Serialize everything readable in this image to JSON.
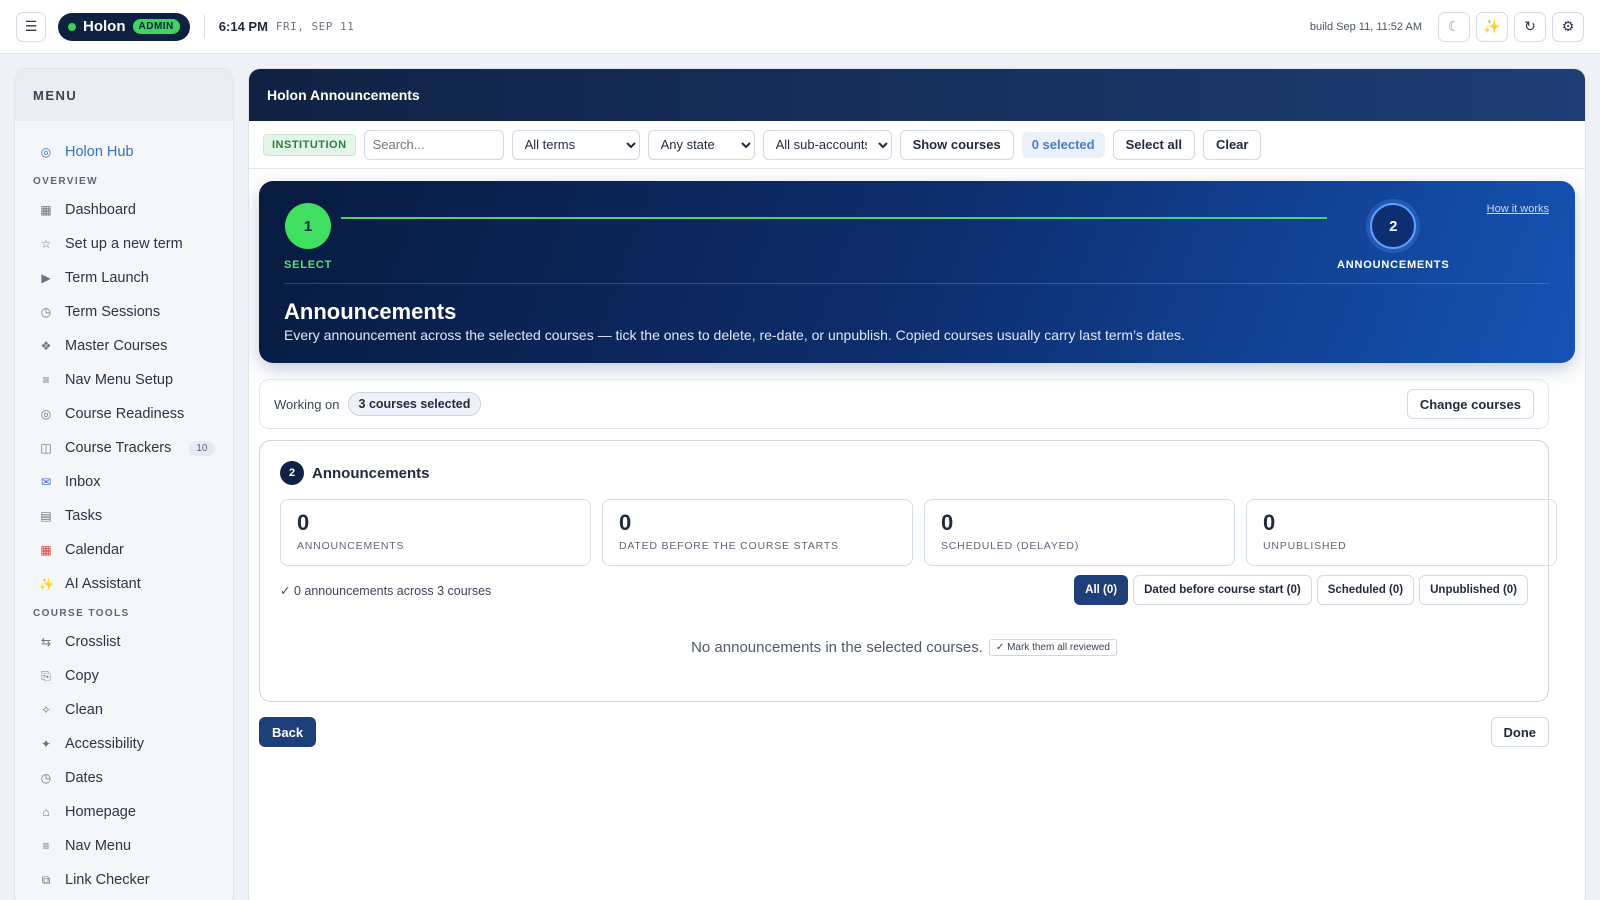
{
  "topbar": {
    "menu_icon": "hamburger-icon",
    "brand_name": "Holon",
    "brand_badge": "ADMIN",
    "time": "6:14 PM",
    "date": "FRI, SEP 11",
    "build": "build Sep 11, 11:52 AM",
    "actions": [
      "moon-icon",
      "sparkles-icon",
      "refresh-icon",
      "gear-icon"
    ]
  },
  "sidebar": {
    "menu_title": "MENU",
    "hub": "Holon Hub",
    "overview_label": "OVERVIEW",
    "overview_items": [
      {
        "label": "Dashboard",
        "icon": "grid-icon"
      },
      {
        "label": "Set up a new term",
        "icon": "star-icon"
      },
      {
        "label": "Term Launch",
        "icon": "play-icon"
      },
      {
        "label": "Term Sessions",
        "icon": "clock-icon"
      },
      {
        "label": "Master Courses",
        "icon": "diamond-icon"
      },
      {
        "label": "Nav Menu Setup",
        "icon": "list-icon"
      },
      {
        "label": "Course Readiness",
        "icon": "target-icon"
      },
      {
        "label": "Course Trackers",
        "icon": "columns-icon",
        "count": "10"
      },
      {
        "label": "Inbox",
        "icon": "mailbox-icon"
      },
      {
        "label": "Tasks",
        "icon": "checklist-icon"
      },
      {
        "label": "Calendar",
        "icon": "calendar-icon"
      },
      {
        "label": "AI Assistant",
        "icon": "sparkles-icon"
      }
    ],
    "tools_label": "COURSE TOOLS",
    "tools_items": [
      {
        "label": "Crosslist",
        "icon": "arrows-icon"
      },
      {
        "label": "Copy",
        "icon": "copy-icon"
      },
      {
        "label": "Clean",
        "icon": "sparkle-icon"
      },
      {
        "label": "Accessibility",
        "icon": "asterisk-icon"
      },
      {
        "label": "Dates",
        "icon": "clock-icon"
      },
      {
        "label": "Homepage",
        "icon": "home-icon"
      },
      {
        "label": "Nav Menu",
        "icon": "list-icon"
      },
      {
        "label": "Link Checker",
        "icon": "link-icon"
      }
    ]
  },
  "main": {
    "title": "Holon Announcements",
    "filters": {
      "institution": "INSTITUTION",
      "search_placeholder": "Search...",
      "terms": "All terms",
      "state": "Any state",
      "subaccounts": "All sub-accounts",
      "show_courses": "Show courses",
      "selected": "0 selected",
      "select_all": "Select all",
      "clear": "Clear"
    },
    "stepper": {
      "step1_num": "1",
      "step1_label": "SELECT",
      "step2_num": "2",
      "step2_label": "ANNOUNCEMENTS",
      "how_it_works": "How it works",
      "title": "Announcements",
      "description": "Every announcement across the selected courses — tick the ones to delete, re-date, or unpublish. Copied courses usually carry last term’s dates."
    },
    "working": {
      "label": "Working on",
      "pill": "3 courses selected",
      "change": "Change courses"
    },
    "card": {
      "step": "2",
      "title": "Announcements",
      "stats": [
        {
          "value": "0",
          "label": "ANNOUNCEMENTS"
        },
        {
          "value": "0",
          "label": "DATED BEFORE THE COURSE STARTS"
        },
        {
          "value": "0",
          "label": "SCHEDULED (DELAYED)"
        },
        {
          "value": "0",
          "label": "UNPUBLISHED"
        }
      ],
      "summary": "✓ 0 announcements across 3 courses",
      "filter_buttons": [
        "All (0)",
        "Dated before course start (0)",
        "Scheduled (0)",
        "Unpublished (0)"
      ],
      "empty_message": "No announcements in the selected courses.",
      "mark_reviewed": "✓ Mark them all reviewed"
    },
    "back": "Back",
    "done": "Done"
  }
}
